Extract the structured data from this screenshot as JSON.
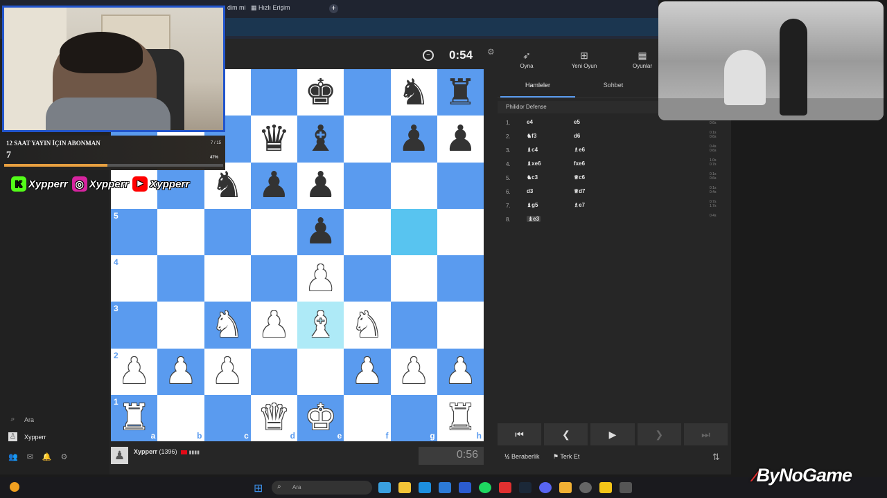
{
  "browser": {
    "tabs": [
      {
        "label": "dim mi"
      },
      {
        "label": "Hızlı Erişim"
      }
    ],
    "new_tab": "+"
  },
  "left_panel": {
    "search_label": "Ara",
    "user_label": "Xypperr"
  },
  "board": {
    "orientation": "white",
    "ranks_labels": [
      "5",
      "4",
      "3",
      "2",
      "1"
    ],
    "files_labels": [
      "a",
      "b",
      "c",
      "d",
      "e",
      "f",
      "g",
      "h"
    ],
    "position": [
      [
        "",
        "",
        "",
        "",
        "bk",
        "",
        "bn",
        "br"
      ],
      [
        "",
        "",
        "",
        "bq",
        "bb",
        "",
        "bp",
        "bp"
      ],
      [
        "",
        "",
        "bn",
        "bp",
        "bp",
        "",
        "",
        ""
      ],
      [
        "",
        "",
        "",
        "",
        "bp",
        "",
        "",
        ""
      ],
      [
        "",
        "",
        "",
        "",
        "wp",
        "",
        "",
        ""
      ],
      [
        "",
        "",
        "wn",
        "wp",
        "wb",
        "wn",
        "",
        ""
      ],
      [
        "wp",
        "wp",
        "wp",
        "",
        "",
        "wp",
        "wp",
        "wp"
      ],
      [
        "wr",
        "",
        "",
        "wq",
        "wk",
        "",
        "",
        "wr"
      ]
    ],
    "highlight_from": "g5",
    "highlight_to": "e3",
    "light_color": "#ffffff",
    "dark_color": "#5a9bef"
  },
  "game": {
    "top_clock": "0:54",
    "bottom_clock": "0:56",
    "player_name": "Xypperr",
    "player_rating": "(1396)",
    "player_bars": "▮▮▮▮"
  },
  "right_panel": {
    "top_actions": [
      {
        "label": "Oyna",
        "icon": "rocket-icon",
        "glyph": "✈"
      },
      {
        "label": "Yeni Oyun",
        "icon": "plus-icon",
        "glyph": "⊞"
      },
      {
        "label": "Oyunlar",
        "icon": "board-icon",
        "glyph": "▦"
      }
    ],
    "tabs": {
      "moves": "Hamleler",
      "chat": "Sohbet"
    },
    "opening": "Philidor Defense",
    "moves": [
      {
        "num": "1.",
        "white": "e4",
        "black": "e5",
        "times": [
          "0.7s",
          "0.6s"
        ]
      },
      {
        "num": "2.",
        "white": "♞f3",
        "black": "d6",
        "times": [
          "0.1s",
          "0.6s"
        ]
      },
      {
        "num": "3.",
        "white": "♝c4",
        "black": "♗e6",
        "times": [
          "0.4s",
          "0.6s"
        ]
      },
      {
        "num": "4.",
        "white": "♝xe6",
        "black": "fxe6",
        "times": [
          "1.0s",
          "0.7s"
        ]
      },
      {
        "num": "5.",
        "white": "♞c3",
        "black": "♕c6",
        "times": [
          "0.1s",
          "0.6s"
        ]
      },
      {
        "num": "6.",
        "white": "d3",
        "black": "♕d7",
        "times": [
          "0.1s",
          "0.4s"
        ]
      },
      {
        "num": "7.",
        "white": "♝g5",
        "black": "♗e7",
        "times": [
          "0.7s",
          "1.7s"
        ]
      },
      {
        "num": "8.",
        "white": "♝e3",
        "black": "",
        "times": [
          "0.4s",
          ""
        ]
      }
    ],
    "nav": {
      "first": "⏮",
      "prev": "❮",
      "play": "▶",
      "next": "❯",
      "last": "⏭"
    },
    "draw_label": "Beraberlik",
    "draw_prefix": "½",
    "resign_label": "Terk Et"
  },
  "overlay": {
    "sub_goal_title": "12 SAAT YAYIN İÇIN ABONMAN",
    "sub_goal_count": "7",
    "sub_goal_ratio": "7 / 15",
    "sub_goal_percent": "47%",
    "sub_goal_progress": 0.47,
    "socials": [
      {
        "platform": "kick",
        "handle": "Xypperr",
        "color": "#53fc18",
        "glyph": "K"
      },
      {
        "platform": "instagram",
        "handle": "Xypperr",
        "color": "#d6249f",
        "glyph": "◎"
      },
      {
        "platform": "youtube",
        "handle": "Xypperr",
        "color": "#ff0000",
        "glyph": "▶"
      }
    ],
    "brand": "ByNoGame"
  },
  "taskbar": {
    "search_placeholder": "Ara"
  }
}
